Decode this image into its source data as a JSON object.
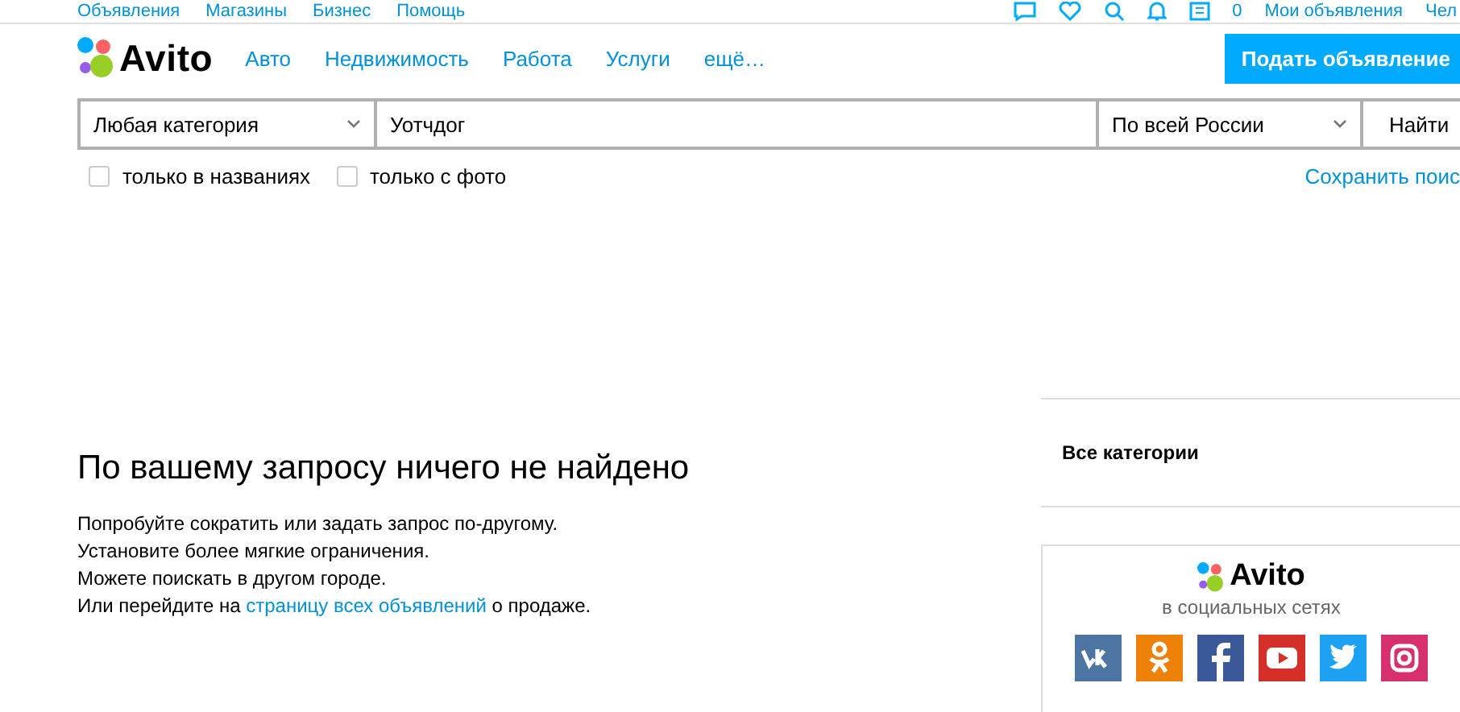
{
  "top_bar": {
    "links": [
      "Объявления",
      "Магазины",
      "Бизнес",
      "Помощь"
    ],
    "counter": "0",
    "my_ads": "Мои объявления",
    "user": "Чел"
  },
  "header": {
    "logo": "Avito",
    "nav": [
      "Авто",
      "Недвижимость",
      "Работа",
      "Услуги",
      "ещё…"
    ],
    "post_button": "Подать объявление"
  },
  "search": {
    "category": "Любая категория",
    "query": "Уотчдог",
    "region": "По всей России",
    "button": "Найти"
  },
  "filters": [
    {
      "label": "только в названиях",
      "checked": false
    },
    {
      "label": "только с фото",
      "checked": false
    }
  ],
  "save_search": "Сохранить поис",
  "result": {
    "title": "По вашему запросу ничего не найдено",
    "lines": [
      "Попробуйте сократить или задать запрос по-другому.",
      "Установите более мягкие ограничения.",
      "Можете поискать в другом городе."
    ],
    "last_before": "Или перейдите на",
    "last_link": "страницу всех объявлений",
    "last_after": "о продаже."
  },
  "sidebar": {
    "categories": "Все категории",
    "social_logo": "Avito",
    "social_caption": "в социальных сетях",
    "networks": [
      {
        "kind": "vk",
        "color": "#4c75a3"
      },
      {
        "kind": "ok",
        "color": "#ee8208"
      },
      {
        "kind": "fb",
        "color": "#3b5998"
      },
      {
        "kind": "yt",
        "color": "#d52f2a"
      },
      {
        "kind": "tw",
        "color": "#1da1f2"
      },
      {
        "kind": "ig",
        "color": "#d6306f"
      }
    ]
  }
}
